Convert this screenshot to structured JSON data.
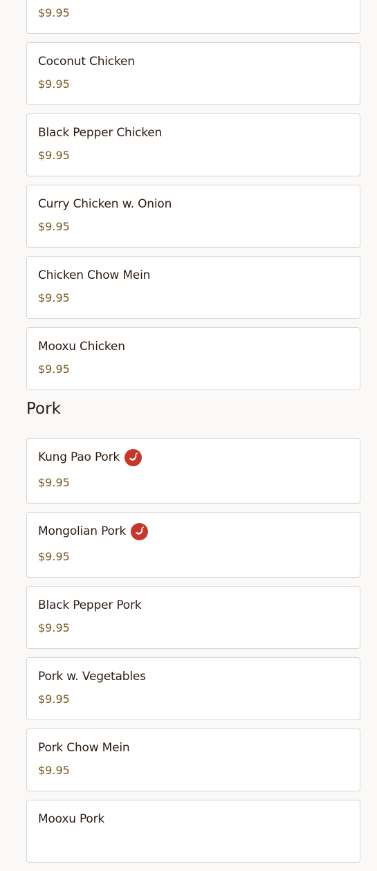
{
  "chicken_items": [
    {
      "name": "",
      "price": "$9.95",
      "spicy": false
    },
    {
      "name": "Coconut Chicken",
      "price": "$9.95",
      "spicy": false
    },
    {
      "name": "Black Pepper Chicken",
      "price": "$9.95",
      "spicy": false
    },
    {
      "name": "Curry Chicken w. Onion",
      "price": "$9.95",
      "spicy": false
    },
    {
      "name": "Chicken Chow Mein",
      "price": "$9.95",
      "spicy": false
    },
    {
      "name": "Mooxu Chicken",
      "price": "$9.95",
      "spicy": false
    }
  ],
  "pork_section": {
    "title": "Pork",
    "items": [
      {
        "name": "Kung Pao Pork",
        "price": "$9.95",
        "spicy": true,
        "icon": "chili-pepper-icon"
      },
      {
        "name": "Mongolian Pork",
        "price": "$9.95",
        "spicy": true,
        "icon": "chili-pepper-icon"
      },
      {
        "name": "Black Pepper Pork",
        "price": "$9.95",
        "spicy": false
      },
      {
        "name": "Pork w. Vegetables",
        "price": "$9.95",
        "spicy": false
      },
      {
        "name": "Pork Chow Mein",
        "price": "$9.95",
        "spicy": false
      },
      {
        "name": "Mooxu Pork",
        "price": "",
        "spicy": false
      }
    ]
  },
  "colors": {
    "background": "#faf9f7",
    "card_border": "#d8d6d2",
    "item_name": "#2b1d14",
    "price": "#7a5a1e",
    "spicy_icon": "#c8362b"
  }
}
